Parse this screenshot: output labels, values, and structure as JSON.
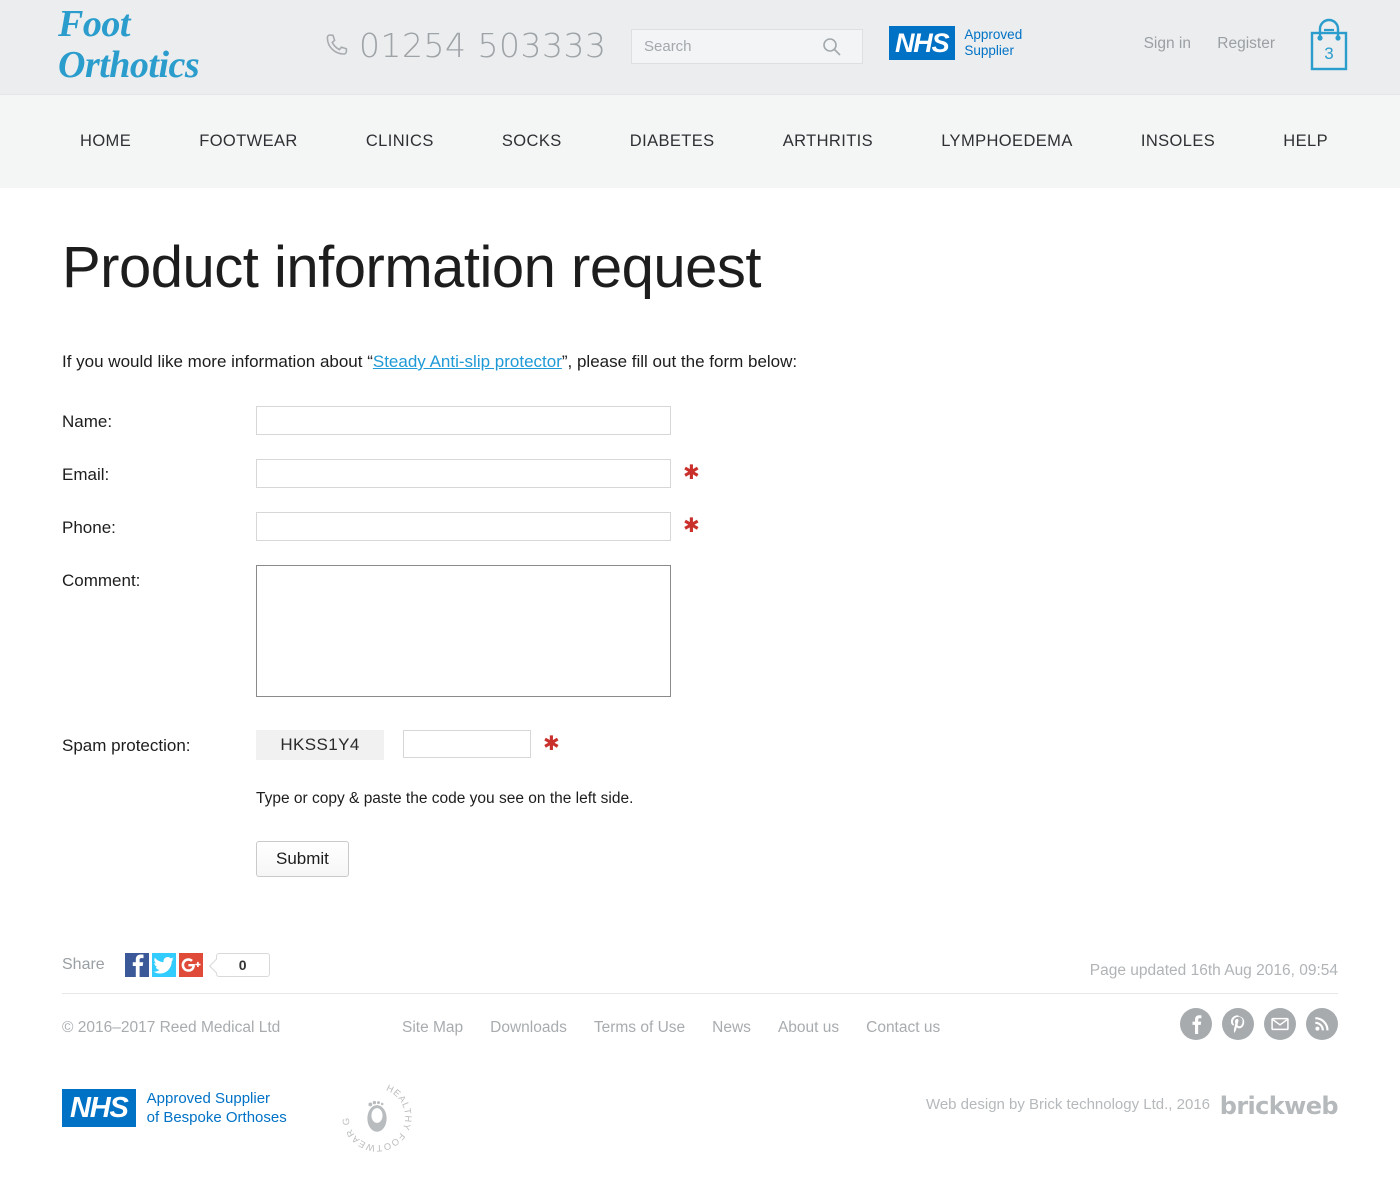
{
  "header": {
    "logo_line1": "Foot",
    "logo_line2": "Orthotics",
    "phone": "01254 503333",
    "phone_icon": "phone-icon",
    "search_placeholder": "Search",
    "search_value": "",
    "search_icon": "search-icon",
    "nhs_mark": "NHS",
    "nhs_line1": "Approved",
    "nhs_line2": "Supplier",
    "sign_in": "Sign in",
    "register": "Register",
    "cart_icon": "shopping-bag-icon",
    "cart_count": "3"
  },
  "nav": {
    "items": [
      {
        "label": "HOME"
      },
      {
        "label": "FOOTWEAR"
      },
      {
        "label": "CLINICS"
      },
      {
        "label": "SOCKS"
      },
      {
        "label": "DIABETES"
      },
      {
        "label": "ARTHRITIS"
      },
      {
        "label": "LYMPHOEDEMA"
      },
      {
        "label": "INSOLES"
      },
      {
        "label": "HELP"
      }
    ]
  },
  "main": {
    "title": "Product information request",
    "intro_prefix": "If you would like more information about “",
    "intro_link": "Steady Anti-slip protector",
    "intro_suffix": "”, please fill out the form below:"
  },
  "form": {
    "name_label": "Name:",
    "name_value": "",
    "email_label": "Email:",
    "email_value": "",
    "phone_label": "Phone:",
    "phone_value": "",
    "comment_label": "Comment:",
    "comment_value": "",
    "spam_label": "Spam protection:",
    "spam_code": "HKSS1Y4",
    "spam_value": "",
    "spam_hint": "Type or copy & paste the code you see on the left side.",
    "required_mark": "✱",
    "submit_label": "Submit"
  },
  "share": {
    "label": "Share",
    "facebook_icon": "facebook-icon",
    "twitter_icon": "twitter-icon",
    "googleplus_icon": "google-plus-icon",
    "count": "0",
    "page_updated": "Page updated 16th Aug 2016, 09:54"
  },
  "footer": {
    "copyright": "© 2016–2017  Reed Medical Ltd",
    "links": [
      {
        "label": "Site Map"
      },
      {
        "label": "Downloads"
      },
      {
        "label": "Terms of Use"
      },
      {
        "label": "News"
      },
      {
        "label": "About us"
      },
      {
        "label": "Contact us"
      }
    ],
    "social": [
      {
        "name": "facebook-icon"
      },
      {
        "name": "pinterest-icon"
      },
      {
        "name": "email-icon"
      },
      {
        "name": "rss-icon"
      }
    ],
    "nhs_mark": "NHS",
    "nhs_line1": "Approved Supplier",
    "nhs_line2": "of Bespoke Orthoses",
    "hfg_badge_text": "HEALTHY FOOTWEAR GUIDE",
    "web_design": "Web design by Brick technology Ltd., 2016",
    "brickweb": "brickweb"
  },
  "colors": {
    "brand_blue": "#2a9dcd",
    "nhs_blue": "#0072c6",
    "link_blue": "#1f9ad6",
    "required_red": "#c9302c",
    "muted_grey": "#a8acaf"
  }
}
